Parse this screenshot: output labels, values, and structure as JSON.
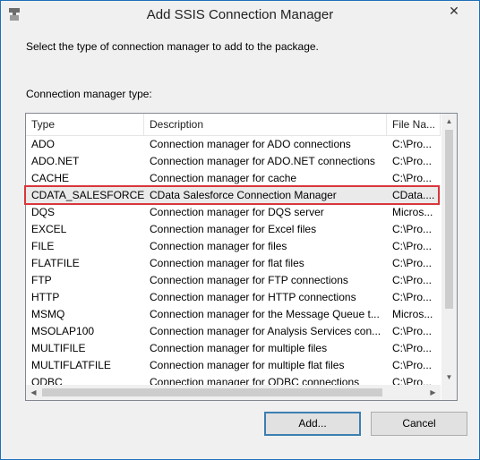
{
  "window": {
    "title": "Add SSIS Connection Manager",
    "close_glyph": "✕",
    "system_icon": "window-system-icon"
  },
  "prompt": "Select the type of connection manager to add to the package.",
  "list_label": "Connection manager type:",
  "columns": [
    "Type",
    "Description",
    "File Na..."
  ],
  "rows": [
    {
      "type": "ADO",
      "description": "Connection manager for ADO connections",
      "file": "C:\\Pro..."
    },
    {
      "type": "ADO.NET",
      "description": "Connection manager for ADO.NET connections",
      "file": "C:\\Pro..."
    },
    {
      "type": "CACHE",
      "description": "Connection manager for cache",
      "file": "C:\\Pro..."
    },
    {
      "type": "CDATA_SALESFORCE",
      "description": "CData Salesforce Connection Manager",
      "file": "CData...."
    },
    {
      "type": "DQS",
      "description": "Connection manager for DQS server",
      "file": "Micros..."
    },
    {
      "type": "EXCEL",
      "description": "Connection manager for Excel files",
      "file": "C:\\Pro..."
    },
    {
      "type": "FILE",
      "description": "Connection manager for files",
      "file": "C:\\Pro..."
    },
    {
      "type": "FLATFILE",
      "description": "Connection manager for flat files",
      "file": "C:\\Pro..."
    },
    {
      "type": "FTP",
      "description": "Connection manager for FTP connections",
      "file": "C:\\Pro..."
    },
    {
      "type": "HTTP",
      "description": "Connection manager for HTTP connections",
      "file": "C:\\Pro..."
    },
    {
      "type": "MSMQ",
      "description": "Connection manager for the Message Queue t...",
      "file": "Micros..."
    },
    {
      "type": "MSOLAP100",
      "description": "Connection manager for Analysis Services con...",
      "file": "C:\\Pro..."
    },
    {
      "type": "MULTIFILE",
      "description": "Connection manager for multiple files",
      "file": "C:\\Pro..."
    },
    {
      "type": "MULTIFLATFILE",
      "description": "Connection manager for multiple flat files",
      "file": "C:\\Pro..."
    },
    {
      "type": "ODBC",
      "description": "Connection manager for ODBC connections",
      "file": "C:\\Pro..."
    }
  ],
  "selected_row": 3,
  "highlight_color": "#d9363a",
  "buttons": {
    "add": "Add...",
    "cancel": "Cancel"
  },
  "scroll_arrows": {
    "up": "▲",
    "down": "▼",
    "left": "◀",
    "right": "▶"
  }
}
